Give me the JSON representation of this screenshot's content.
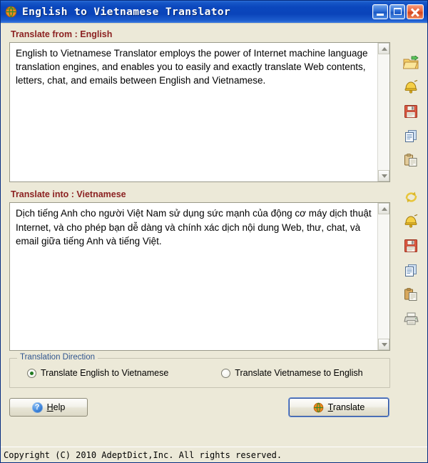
{
  "window": {
    "title": "English to Vietnamese Translator",
    "icon": "globe-icon",
    "buttons": {
      "minimize": "Minimize",
      "maximize": "Maximize",
      "close": "Close"
    }
  },
  "source": {
    "label": "Translate from : English",
    "text": "English to Vietnamese Translator employs the power of Internet machine language translation engines, and enables you to easily and exactly translate Web contents, letters, chat, and emails between English and Vietnamese."
  },
  "target": {
    "label": "Translate into : Vietnamese",
    "text": "Dịch tiếng Anh cho người Việt Nam sử dụng sức mạnh của động cơ máy dịch thuật Internet, và cho phép bạn dễ dàng và chính xác dịch nội dung Web, thư, chat, và email giữa tiếng Anh và tiếng Việt."
  },
  "toolbar_source": [
    {
      "name": "open-file-icon",
      "title": "Open"
    },
    {
      "name": "speak-icon",
      "title": "Speak"
    },
    {
      "name": "save-icon",
      "title": "Save"
    },
    {
      "name": "copy-icon",
      "title": "Copy"
    },
    {
      "name": "paste-icon",
      "title": "Paste"
    }
  ],
  "toolbar_target": [
    {
      "name": "refresh-icon",
      "title": "Swap"
    },
    {
      "name": "speak-icon",
      "title": "Speak"
    },
    {
      "name": "save-icon",
      "title": "Save"
    },
    {
      "name": "copy-icon",
      "title": "Copy"
    },
    {
      "name": "paste-icon",
      "title": "Paste"
    },
    {
      "name": "print-icon",
      "title": "Print"
    }
  ],
  "direction": {
    "group_label": "Translation Direction",
    "options": [
      {
        "label": "Translate English to Vietnamese",
        "selected": true
      },
      {
        "label": "Translate Vietnamese to English",
        "selected": false
      }
    ]
  },
  "actions": {
    "help_label": "Help",
    "help_icon": "question-mark-icon",
    "translate_label": "Translate",
    "translate_icon": "globe-icon"
  },
  "statusbar": {
    "text": "Copyright (C) 2010 AdeptDict,Inc. All rights reserved."
  },
  "colors": {
    "titlebar": "#0a44ba",
    "client": "#ece9d8",
    "field_label": "#8c2222",
    "group_label": "#31568f",
    "radio_dot": "#1f7a1f"
  }
}
